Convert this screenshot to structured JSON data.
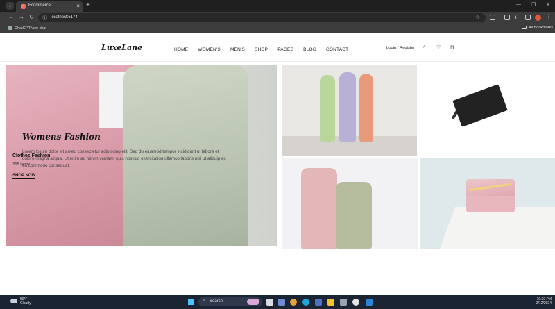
{
  "browser": {
    "tab_title": "Ecommerce",
    "tab_close": "×",
    "new_tab": "+",
    "url": "localhost:5174",
    "bookmark_label": "ChatGPTNew chat",
    "all_bookmarks": "All Bookmarks"
  },
  "site": {
    "logo": "LuxeLane",
    "nav": [
      "HOME",
      "WOMEN'S",
      "MEN'S",
      "SHOP",
      "PAGES",
      "BLOG",
      "CONTACT"
    ],
    "login": "Login / Register"
  },
  "hero": {
    "title": "Womens Fashion",
    "text": "Lorem ipsum dolor sit amet, consectetur adipiscing elit. Sed do eiusmod tempor incididunt ut labore et dolore magna aliqua. Ut enim ad minim veniam, quis nostrud exercitation ullamco laboris nisi ut aliquip ex ea commodo consequat.",
    "category": "Clothes Fashion",
    "items": "358 items",
    "shop_now": "SHOP NOW"
  },
  "taskbar": {
    "temp": "59°F",
    "condition": "Cloudy",
    "search": "Search",
    "time": "10:20 PM",
    "date": "2/12/2024"
  }
}
